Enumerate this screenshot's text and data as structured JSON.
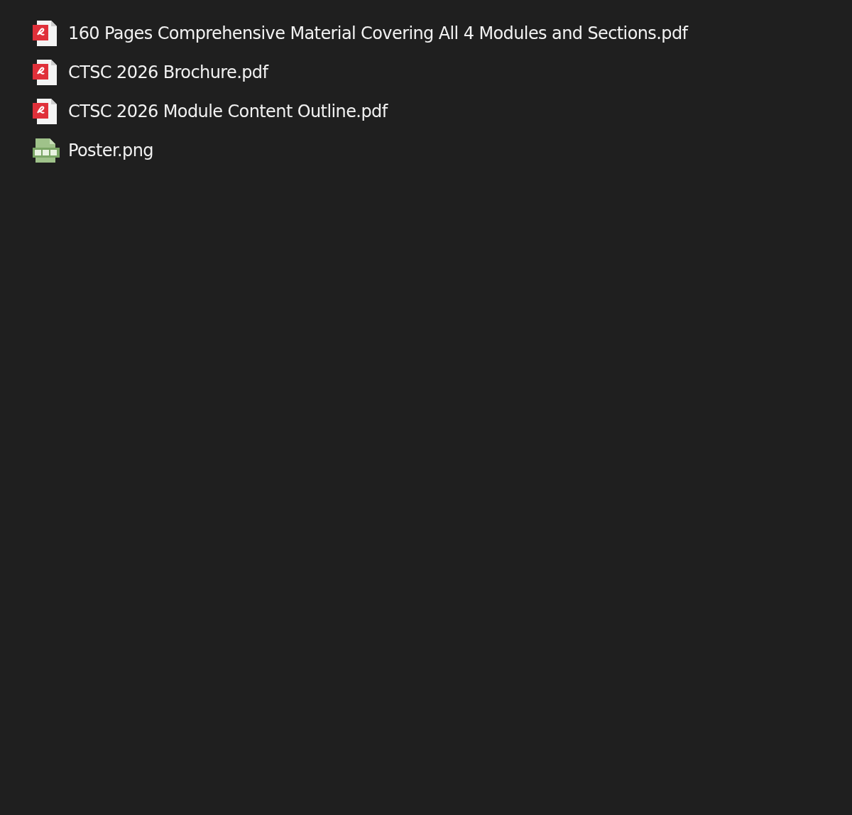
{
  "files": [
    {
      "name": "160 Pages Comprehensive Material Covering All 4 Modules and Sections.pdf",
      "kind": "pdf"
    },
    {
      "name": "CTSC 2026 Brochure.pdf",
      "kind": "pdf"
    },
    {
      "name": "CTSC 2026 Module Content Outline.pdf",
      "kind": "pdf"
    },
    {
      "name": "Poster.png",
      "kind": "png"
    }
  ]
}
